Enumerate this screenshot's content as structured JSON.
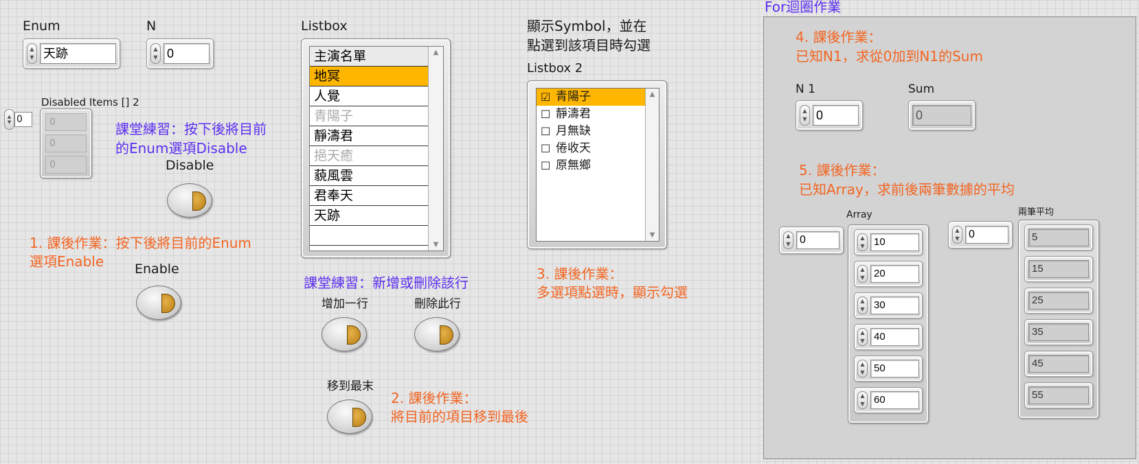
{
  "enum": {
    "label": "Enum",
    "value": "天跡"
  },
  "n": {
    "label": "N",
    "value": "0"
  },
  "disabled_items": {
    "label": "Disabled Items [] 2",
    "index": "0",
    "values": [
      "0",
      "0",
      "0"
    ]
  },
  "note_disable": "課堂練習：按下後將目前的Enum選項Disable",
  "disable_button": {
    "label": "Disable"
  },
  "note_enable_1": "1. 課後作業：按下後將目前的Enum",
  "note_enable_2": "選項Enable",
  "enable_button": {
    "label": "Enable"
  },
  "listbox": {
    "label": "Listbox",
    "header": "主演名單",
    "rows": [
      {
        "text": "地冥",
        "state": "sel"
      },
      {
        "text": "人覺",
        "state": ""
      },
      {
        "text": "青陽子",
        "state": "dis"
      },
      {
        "text": "靜濤君",
        "state": ""
      },
      {
        "text": "挹天癒",
        "state": "dis"
      },
      {
        "text": "藐風雲",
        "state": ""
      },
      {
        "text": "君奉天",
        "state": ""
      },
      {
        "text": "天跡",
        "state": ""
      },
      {
        "text": "",
        "state": ""
      }
    ]
  },
  "note_listbox": "課堂練習：新增或刪除該行",
  "add_row_button": {
    "label": "增加一行"
  },
  "delete_row_button": {
    "label": "刪除此行"
  },
  "move_last_button": {
    "label": "移到最末"
  },
  "note_hw2_1": "2. 課後作業：",
  "note_hw2_2": "將目前的項目移到最後",
  "note_symbol_1": "顯示Symbol，並在",
  "note_symbol_2": "點選到該項目時勾選",
  "listbox2": {
    "label": "Listbox 2",
    "rows": [
      {
        "text": "青陽子",
        "checked": true,
        "symbol": "☑"
      },
      {
        "text": "靜濤君",
        "checked": false,
        "symbol": "☐"
      },
      {
        "text": "月無缺",
        "checked": false,
        "symbol": "☐"
      },
      {
        "text": "倦收天",
        "checked": false,
        "symbol": "☐"
      },
      {
        "text": "原無鄉",
        "checked": false,
        "symbol": "☐"
      }
    ]
  },
  "note_hw3_1": "3. 課後作業：",
  "note_hw3_2": "多選項點選時，顯示勾選",
  "for_loop": {
    "title": "For迴圈作業",
    "hw4_1": "4. 課後作業：",
    "hw4_2": "已知N1，求從0加到N1的Sum",
    "n1": {
      "label": "N 1",
      "value": "0"
    },
    "sum": {
      "label": "Sum",
      "value": "0"
    },
    "hw5_1": "5. 課後作業：",
    "hw5_2": "已知Array，求前後兩筆數據的平均",
    "array": {
      "label": "Array",
      "index": "0",
      "values": [
        "10",
        "20",
        "30",
        "40",
        "50",
        "60"
      ]
    },
    "avg": {
      "label": "兩筆平均",
      "index": "0",
      "values": [
        "5",
        "15",
        "25",
        "35",
        "45",
        "55"
      ]
    }
  },
  "colors": {
    "selected": "#ffb600",
    "orange_note": "#f26522",
    "purple_note": "#5b2ff0"
  }
}
